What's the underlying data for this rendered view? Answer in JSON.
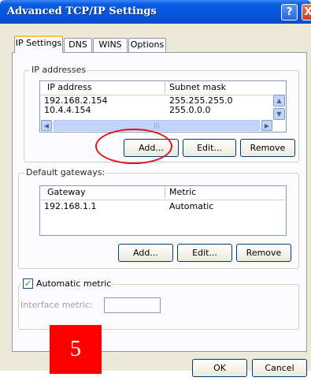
{
  "window": {
    "title": "Advanced TCP/IP Settings",
    "help_glyph": "?",
    "close_glyph": "X"
  },
  "tabs": [
    {
      "label": "IP Settings",
      "active": true
    },
    {
      "label": "DNS",
      "active": false
    },
    {
      "label": "WINS",
      "active": false
    },
    {
      "label": "Options",
      "active": false
    }
  ],
  "ip_addresses": {
    "group_label": "IP addresses",
    "columns": [
      "IP address",
      "Subnet mask"
    ],
    "rows": [
      {
        "ip": "192.168.2.154",
        "mask": "255.255.255.0"
      },
      {
        "ip": "10.4.4.154",
        "mask": "255.0.0.0"
      }
    ],
    "buttons": {
      "add": "Add...",
      "edit": "Edit...",
      "remove": "Remove"
    }
  },
  "gateways": {
    "group_label": "Default gateways:",
    "columns": [
      "Gateway",
      "Metric"
    ],
    "rows": [
      {
        "gateway": "192.168.1.1",
        "metric": "Automatic"
      }
    ],
    "buttons": {
      "add": "Add...",
      "edit": "Edit...",
      "remove": "Remove"
    }
  },
  "metric": {
    "checkbox_label": "Automatic metric",
    "checked": true,
    "interface_label": "Interface metric:",
    "interface_value": ""
  },
  "footer": {
    "ok": "OK",
    "cancel": "Cancel"
  },
  "annotation": {
    "step_number": "5",
    "highlight_color": "#e2141d"
  }
}
